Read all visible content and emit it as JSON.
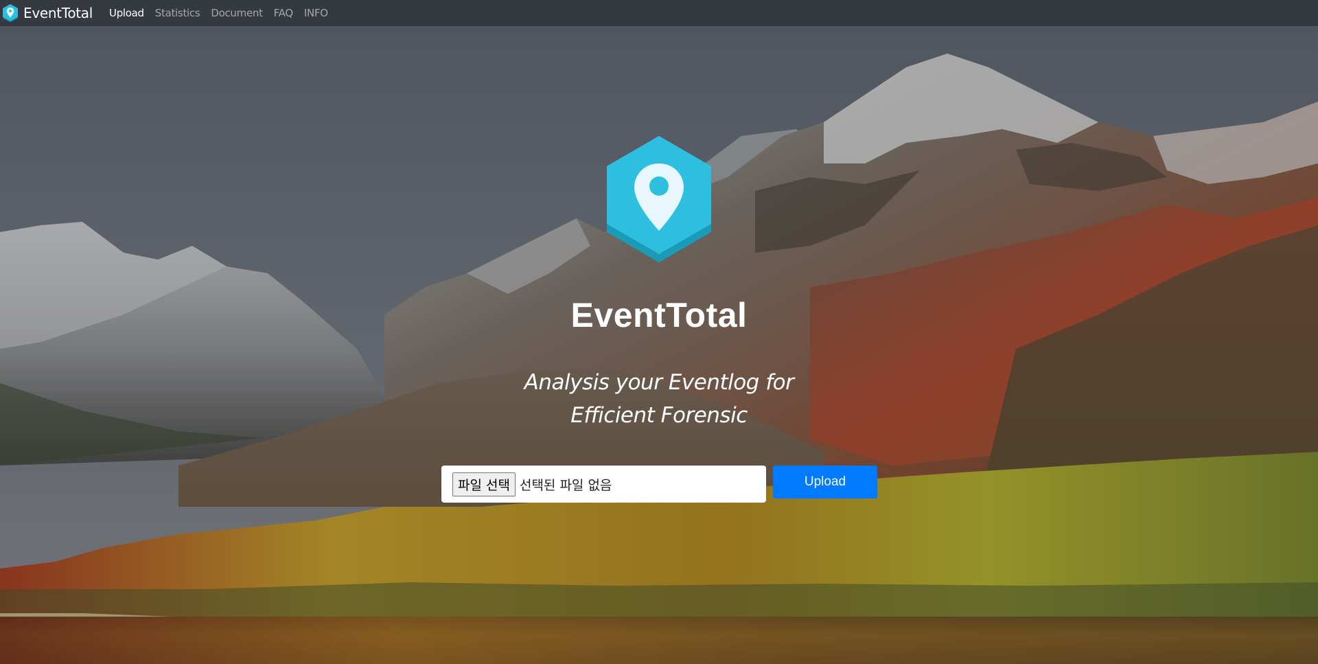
{
  "navbar": {
    "brand_name": "EventTotal",
    "links": [
      {
        "label": "Upload",
        "active": true
      },
      {
        "label": "Statistics",
        "active": false
      },
      {
        "label": "Document",
        "active": false
      },
      {
        "label": "FAQ",
        "active": false
      },
      {
        "label": "INFO",
        "active": false
      }
    ]
  },
  "hero": {
    "logo_icon": "map-pin-hexagon-icon",
    "title": "EventTotal",
    "subtitle_line1": "Analysis your Eventlog for",
    "subtitle_line2": "Efficient Forensic"
  },
  "upload_form": {
    "file_button_label": "파일 선택",
    "file_status": "선택된 파일 없음",
    "submit_label": "Upload"
  },
  "colors": {
    "navbar_bg": "#343a40",
    "brand_accent": "#2ebfe0",
    "primary_button": "#007bff"
  }
}
